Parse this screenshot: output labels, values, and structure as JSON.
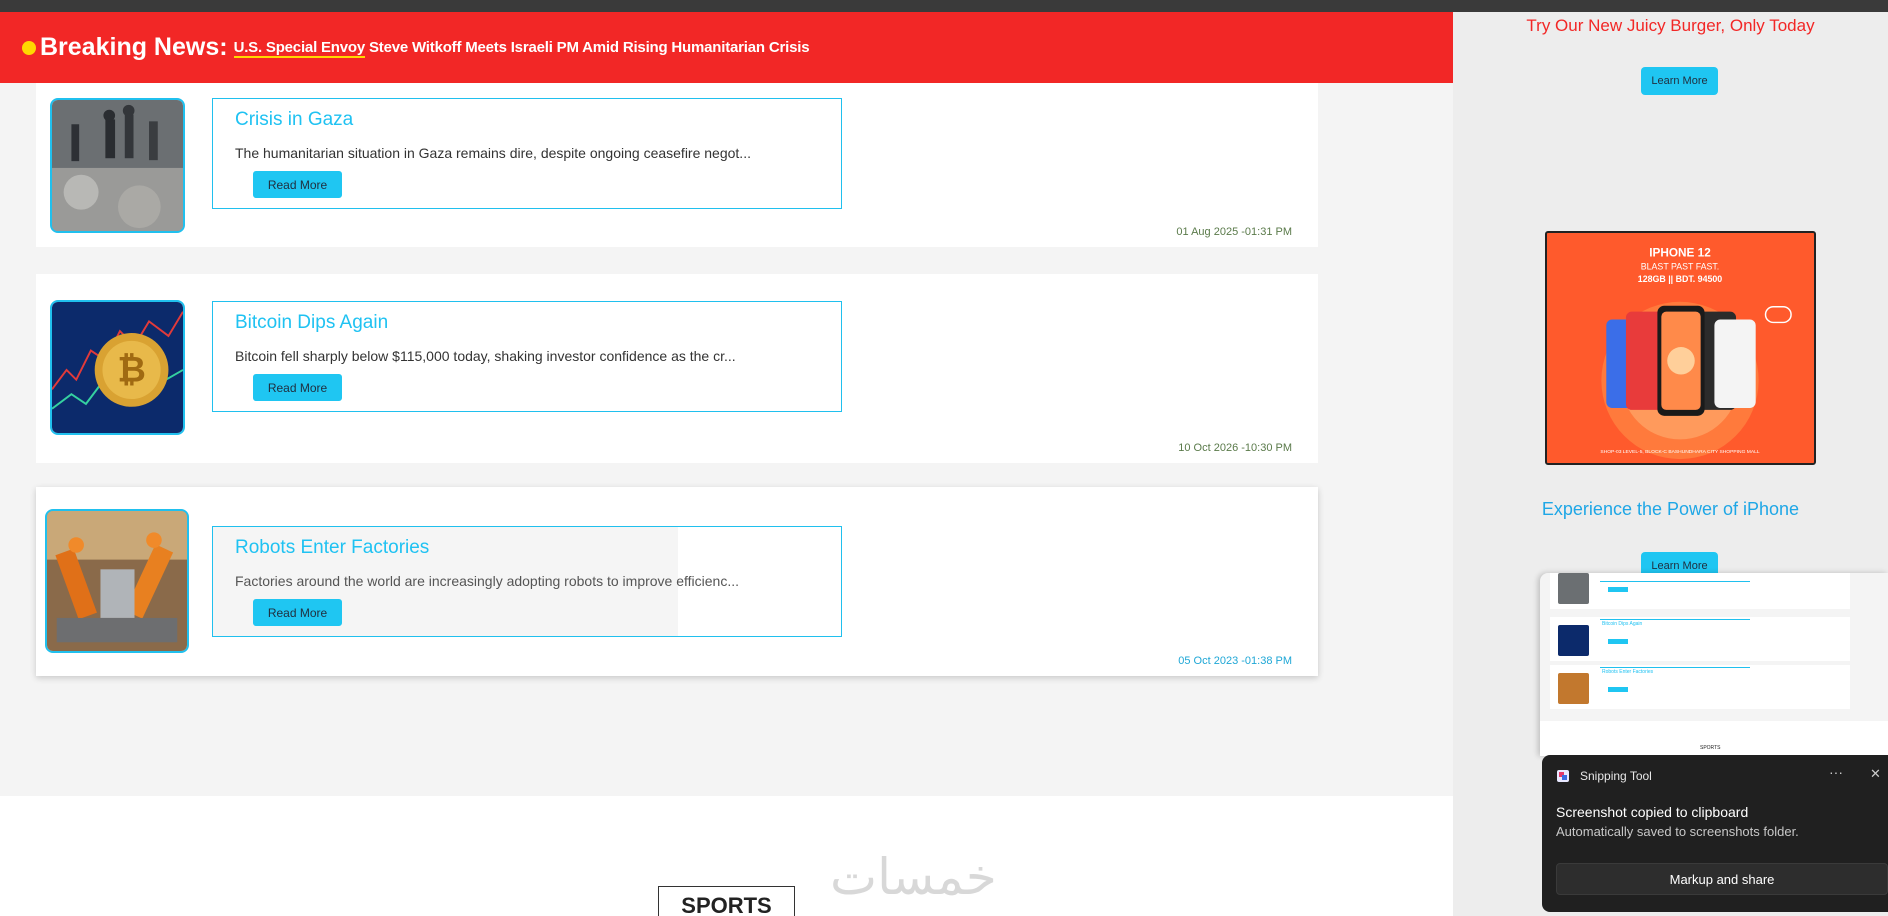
{
  "breaking": {
    "label": "Breaking News:",
    "headline_highlight": "U.S. Special Envoy",
    "headline_rest": " Steve Witkoff Meets Israeli PM Amid Rising Humanitarian Crisis"
  },
  "articles": [
    {
      "title": "Crisis in Gaza",
      "description": "The humanitarian situation in Gaza remains dire, despite ongoing ceasefire negot...",
      "button": "Read More",
      "date": "01 Aug 2025 -01:31 PM"
    },
    {
      "title": "Bitcoin Dips Again",
      "description": "Bitcoin fell sharply below $115,000 today, shaking investor confidence as the cr...",
      "button": "Read More",
      "date": "10 Oct 2026 -10:30 PM"
    },
    {
      "title": "Robots Enter Factories",
      "description": "Factories around the world are increasingly adopting robots to improve efficienc...",
      "button": "Read More",
      "date": "05 Oct 2023 -01:38 PM"
    }
  ],
  "sports_label": "SPORTS",
  "watermark": "خمسات",
  "sidebar": {
    "ad1_title": "Try Our New Juicy Burger, Only Today",
    "ad1_button": "Learn More",
    "ad2_image": {
      "line1": "IPHONE 12",
      "line2": "BLAST PAST FAST.",
      "line3": "128GB  || BDT. 94500",
      "footer": "SHOP-03 LEVEL-5, BLOCK-C BASHUNDHARA CITY SHOPPING MALL"
    },
    "ad2_title": "Experience the Power of iPhone",
    "ad2_button": "Learn More"
  },
  "toast": {
    "app": "Snipping Tool",
    "title": "Screenshot copied to clipboard",
    "subtitle": "Automatically saved to screenshots folder.",
    "button": "Markup and share",
    "more": "···",
    "close": "✕"
  },
  "colors": {
    "breaking_bg": "#f22726",
    "accent": "#1fc2f2",
    "highlight": "#ffd800"
  }
}
